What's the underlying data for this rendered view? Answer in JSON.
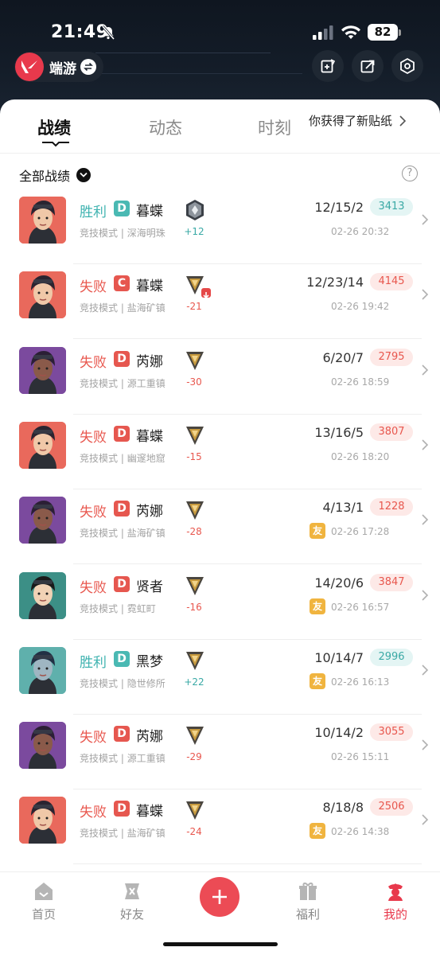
{
  "status_bar": {
    "time": "21:49",
    "battery": "82"
  },
  "header": {
    "app_name": "端游"
  },
  "tabs": [
    {
      "label": "战绩",
      "active": true
    },
    {
      "label": "动态",
      "active": false
    },
    {
      "label": "时刻",
      "active": false
    }
  ],
  "sticker_notice": "你获得了新贴纸",
  "filter": {
    "label": "全部战绩",
    "help_symbol": "?"
  },
  "colors": {
    "win": "#3fb3b0",
    "lose": "#e8574e",
    "brand": "#e8394c",
    "friend_badge": "#f0b43f"
  },
  "matches": [
    {
      "result": "胜利",
      "outcome": "win",
      "grade": "D",
      "agent": "暮蝶",
      "mode": "竞技模式",
      "map": "深海明珠",
      "delta": "+12",
      "kda": "12/15/2",
      "score": "3413",
      "time": "02-26 20:32",
      "friend": "",
      "rank_icon": "silver-rank-icon",
      "rank_down": false
    },
    {
      "result": "失败",
      "outcome": "lose",
      "grade": "C",
      "agent": "暮蝶",
      "mode": "竞技模式",
      "map": "盐海矿镇",
      "delta": "-21",
      "kda": "12/23/14",
      "score": "4145",
      "time": "02-26 19:42",
      "friend": "",
      "rank_icon": "gold-rank-icon",
      "rank_down": true
    },
    {
      "result": "失败",
      "outcome": "lose",
      "grade": "D",
      "agent": "芮娜",
      "mode": "竞技模式",
      "map": "源工重镇",
      "delta": "-30",
      "kda": "6/20/7",
      "score": "2795",
      "time": "02-26 18:59",
      "friend": "",
      "rank_icon": "gold-rank-icon",
      "rank_down": false
    },
    {
      "result": "失败",
      "outcome": "lose",
      "grade": "D",
      "agent": "暮蝶",
      "mode": "竞技模式",
      "map": "幽邃地窟",
      "delta": "-15",
      "kda": "13/16/5",
      "score": "3807",
      "time": "02-26 18:20",
      "friend": "",
      "rank_icon": "gold-rank-icon",
      "rank_down": false
    },
    {
      "result": "失败",
      "outcome": "lose",
      "grade": "D",
      "agent": "芮娜",
      "mode": "竞技模式",
      "map": "盐海矿镇",
      "delta": "-28",
      "kda": "4/13/1",
      "score": "1228",
      "time": "02-26 17:28",
      "friend": "友",
      "rank_icon": "gold-rank-icon",
      "rank_down": false
    },
    {
      "result": "失败",
      "outcome": "lose",
      "grade": "D",
      "agent": "贤者",
      "mode": "竞技模式",
      "map": "霓虹町",
      "delta": "-16",
      "kda": "14/20/6",
      "score": "3847",
      "time": "02-26 16:57",
      "friend": "友",
      "rank_icon": "gold-rank-icon",
      "rank_down": false
    },
    {
      "result": "胜利",
      "outcome": "win",
      "grade": "D",
      "agent": "黑梦",
      "mode": "竞技模式",
      "map": "隐世修所",
      "delta": "+22",
      "kda": "10/14/7",
      "score": "2996",
      "time": "02-26 16:13",
      "friend": "友",
      "rank_icon": "gold-rank-icon",
      "rank_down": false
    },
    {
      "result": "失败",
      "outcome": "lose",
      "grade": "D",
      "agent": "芮娜",
      "mode": "竞技模式",
      "map": "源工重镇",
      "delta": "-29",
      "kda": "10/14/2",
      "score": "3055",
      "time": "02-26 15:11",
      "friend": "",
      "rank_icon": "gold-rank-icon",
      "rank_down": false
    },
    {
      "result": "失败",
      "outcome": "lose",
      "grade": "D",
      "agent": "暮蝶",
      "mode": "竞技模式",
      "map": "盐海矿镇",
      "delta": "-24",
      "kda": "8/18/8",
      "score": "2506",
      "time": "02-26 14:38",
      "friend": "友",
      "rank_icon": "gold-rank-icon",
      "rank_down": false
    }
  ],
  "bottom_nav": [
    {
      "label": "首页",
      "icon": "home-icon"
    },
    {
      "label": "好友",
      "icon": "friends-icon"
    },
    {
      "label": "福利",
      "icon": "gift-icon"
    },
    {
      "label": "我的",
      "icon": "profile-icon",
      "active": true
    }
  ]
}
